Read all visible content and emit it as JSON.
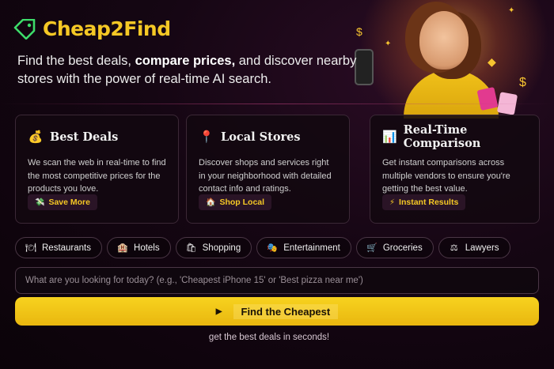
{
  "brand": {
    "name": "Cheap2Find",
    "tagline_part1": "Find the best deals, ",
    "tagline_bold": "compare prices,",
    "tagline_part2": " and discover nearby stores with the power of real-time AI search."
  },
  "cards": [
    {
      "icon": "money-bag-icon",
      "title": "Best Deals",
      "description": "We scan the web in real-time to find the most competitive prices for the products you love.",
      "pill_icon": "money-wings-icon",
      "pill_label": "Save More"
    },
    {
      "icon": "map-pin-icon",
      "title": "Local Stores",
      "description": "Discover shops and services right in your neighborhood with detailed contact info and ratings.",
      "pill_icon": "house-icon",
      "pill_label": "Shop Local"
    },
    {
      "icon": "bar-chart-icon",
      "title": "Real-Time Comparison",
      "description": "Get instant comparisons across multiple vendors to ensure you're getting the best value.",
      "pill_icon": "lightning-icon",
      "pill_label": "Instant Results"
    }
  ],
  "categories": [
    {
      "label": "Restaurants",
      "icon": "plate-icon"
    },
    {
      "label": "Hotels",
      "icon": "hotel-icon"
    },
    {
      "label": "Shopping",
      "icon": "shopping-bags-icon"
    },
    {
      "label": "Entertainment",
      "icon": "theater-masks-icon"
    },
    {
      "label": "Groceries",
      "icon": "cart-icon"
    },
    {
      "label": "Lawyers",
      "icon": "scales-icon"
    }
  ],
  "search": {
    "placeholder": "What are you looking for today? (e.g., 'Cheapest iPhone 15' or 'Best pizza near me')",
    "value": ""
  },
  "cta": {
    "label": "Find the Cheapest",
    "icon": "play-triangle-icon"
  },
  "subtext": "get the best deals in seconds!",
  "colors": {
    "accent": "#f5c825",
    "background": "#150613",
    "card_border": "#3b2836"
  }
}
